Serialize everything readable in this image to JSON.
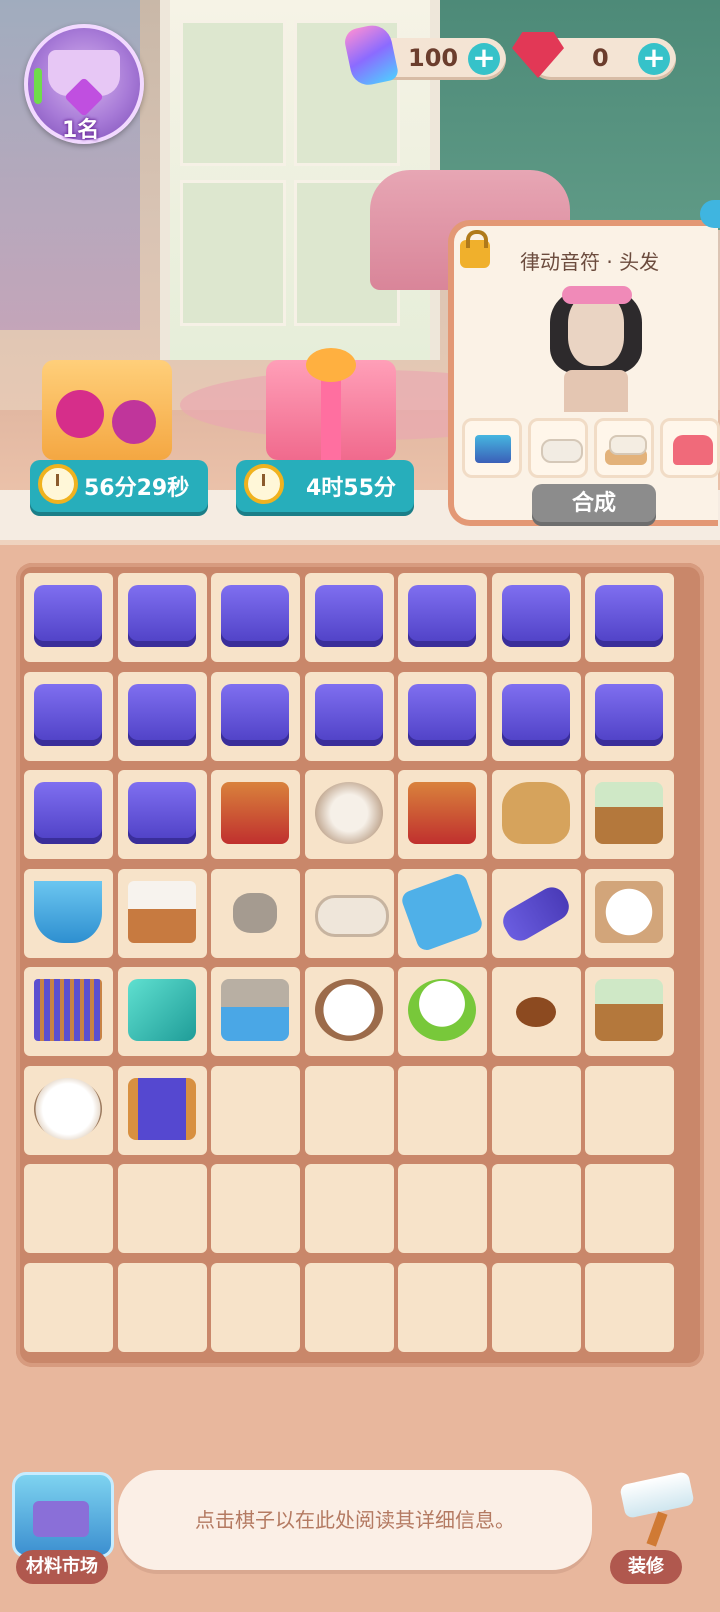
{
  "player": {
    "rank_label": "1名"
  },
  "currencies": {
    "energy": {
      "value": "100",
      "icon": "energy-bolt-icon"
    },
    "gems": {
      "value": "0",
      "icon": "ruby-gem-icon"
    }
  },
  "gift_timers": [
    {
      "label": "56分29秒",
      "icon": "thread-spool-gift-icon"
    },
    {
      "label": "4时55分",
      "icon": "vip-gift-box-icon"
    }
  ],
  "recipe_card": {
    "title": "律动音符 · 头发",
    "synthesize_label": "合成",
    "ingredients": [
      "folded-fabric-stack-icon",
      "rolled-towel-icon",
      "rolled-towel-tray-icon",
      "sewing-machine-icon"
    ]
  },
  "board": {
    "rows": 8,
    "cols": 7,
    "items": [
      [
        "sewing-kit",
        "sewing-kit",
        "sewing-kit",
        "sewing-kit",
        "sewing-kit",
        "sewing-kit",
        "sewing-kit"
      ],
      [
        "sewing-kit",
        "sewing-kit",
        "sewing-kit",
        "sewing-kit",
        "sewing-kit",
        "sewing-kit",
        "sewing-kit"
      ],
      [
        "sewing-kit",
        "sewing-kit",
        "log-cart",
        "cloth-rolls",
        "log-cart",
        "seed-sack",
        "seedling-box"
      ],
      [
        "stone-bucket",
        "cotton-crate",
        "stone",
        "cloth-roll",
        "stone-scoop",
        "thread-spool",
        "cotton-tray"
      ],
      [
        "loom",
        "fabric",
        "stone-cart",
        "cotton-pile",
        "dog",
        "seed",
        "seedling-box"
      ],
      [
        "cotton-flower",
        "thread-bobbin",
        "",
        "",
        "",
        "",
        ""
      ],
      [
        "",
        "",
        "",
        "",
        "",
        "",
        ""
      ],
      [
        "",
        "",
        "",
        "",
        "",
        "",
        ""
      ]
    ]
  },
  "footer": {
    "market_label": "材料市场",
    "info_text": "点击棋子以在此处阅读其详细信息。",
    "decorate_label": "装修"
  }
}
